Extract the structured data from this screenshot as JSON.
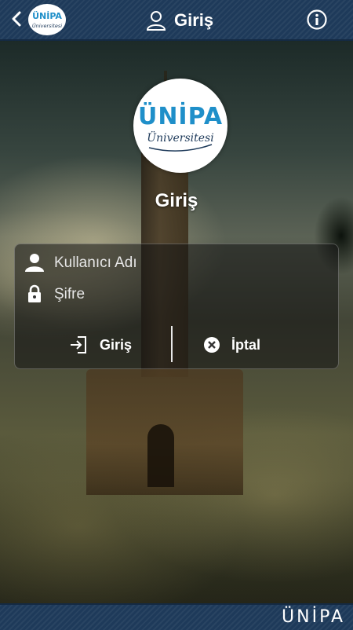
{
  "header": {
    "title": "Giriş",
    "logo_text": "ÜNİPA",
    "logo_subtext": "Üniversitesi"
  },
  "logo": {
    "name": "ÜNİPA",
    "subtitle": "Üniversitesi",
    "accent": "#1f8fc9",
    "ink": "#1e3a5a"
  },
  "main": {
    "heading": "Giriş"
  },
  "form": {
    "username_placeholder": "Kullanıcı Adı",
    "password_placeholder": "Şifre",
    "username_value": "",
    "password_value": ""
  },
  "buttons": {
    "login_label": "Giriş",
    "cancel_label": "İptal"
  },
  "footer": {
    "brand": "ÜNİPA"
  },
  "colors": {
    "header_bg": "#1e3a5a",
    "text": "#ffffff"
  },
  "icons": {
    "back": "chevron-left-icon",
    "user": "user-icon",
    "info": "info-icon",
    "lock": "lock-icon",
    "login": "login-icon",
    "cancel": "close-circle-icon"
  }
}
